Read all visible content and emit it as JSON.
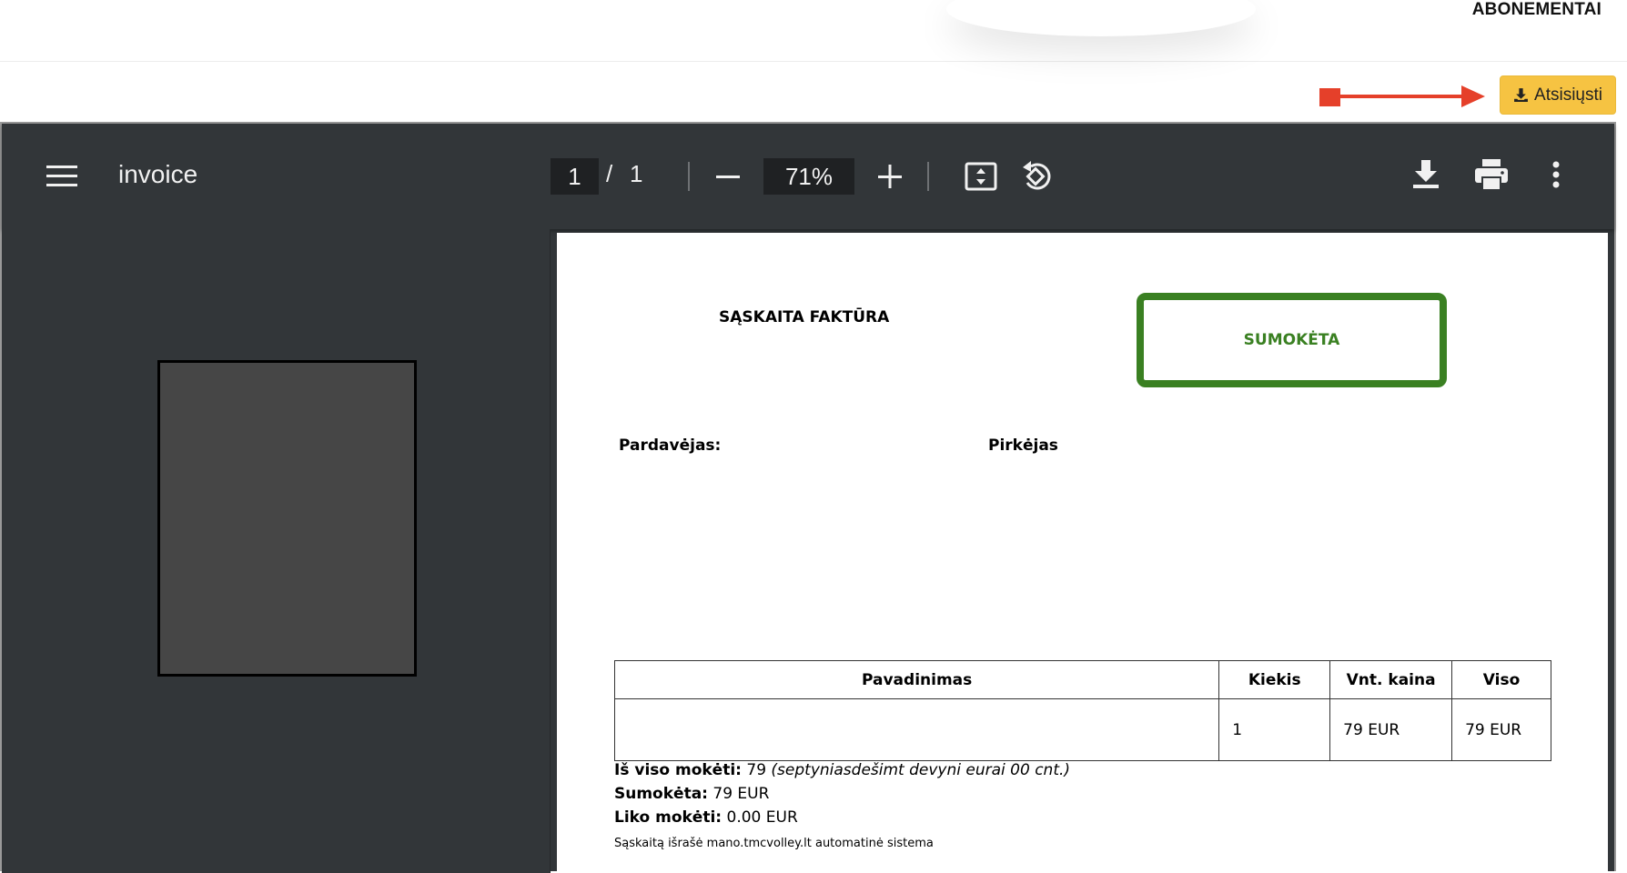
{
  "header": {
    "nav_item": "ABONEMENTAI"
  },
  "actions": {
    "download_label": "Atsisiųsti",
    "annotation_color": "#e5402a",
    "button_color": "#f6c342"
  },
  "viewer": {
    "title": "invoice",
    "current_page": "1",
    "page_separator": "/",
    "total_pages": "1",
    "zoom": "71%",
    "icons": [
      "menu-icon",
      "minus-icon",
      "plus-icon",
      "fit-page-icon",
      "rotate-icon",
      "download-icon",
      "print-icon",
      "more-options-icon"
    ]
  },
  "invoice": {
    "heading": "SĄSKAITA FAKTŪRA",
    "stamp": "SUMOKĖTA",
    "stamp_color": "#3a8022",
    "seller_label": "Pardavėjas:",
    "buyer_label": "Pirkėjas",
    "table": {
      "headers": [
        "Pavadinimas",
        "Kiekis",
        "Vnt. kaina",
        "Viso"
      ],
      "rows": [
        {
          "name": "",
          "quantity": "1",
          "unit_price": "79 EUR",
          "total": "79 EUR"
        }
      ]
    },
    "summary": {
      "total_label": "Iš viso mokėti:",
      "total_value": "79",
      "total_words": "(septyniasdešimt devyni eurai 00 cnt.)",
      "paid_label": "Sumokėta:",
      "paid_value": "79 EUR",
      "remaining_label": "Liko mokėti:",
      "remaining_value": "0.00 EUR"
    },
    "footer": "Sąskaitą išrašė mano.tmcvolley.lt automatinė sistema"
  }
}
